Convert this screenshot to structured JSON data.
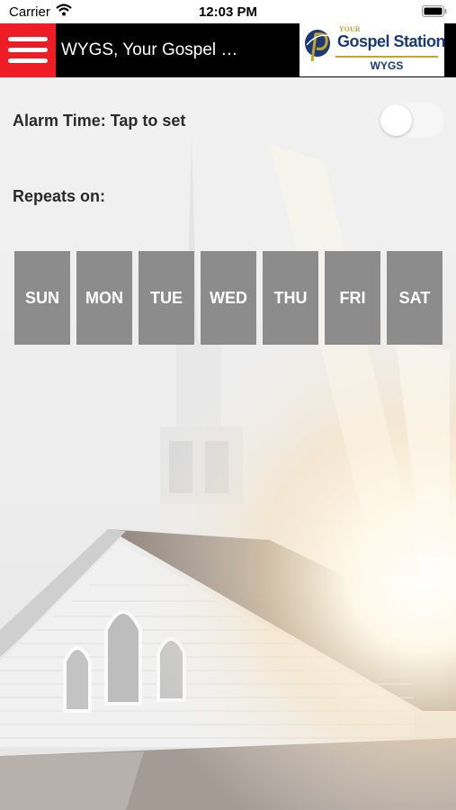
{
  "status_bar": {
    "carrier": "Carrier",
    "time": "12:03 PM"
  },
  "nav": {
    "title": "WYGS, Your Gospel …",
    "logo": {
      "your": "YOUR",
      "name": "Gospel Station",
      "callsign": "WYGS"
    }
  },
  "alarm": {
    "label": "Alarm Time: Tap to set",
    "enabled": false
  },
  "repeats": {
    "label": "Repeats on:",
    "days": [
      "SUN",
      "MON",
      "TUE",
      "WED",
      "THU",
      "FRI",
      "SAT"
    ]
  },
  "colors": {
    "menu_red": "#ee1c24",
    "nav_black": "#000000",
    "day_gray": "#8c8c8c",
    "logo_blue": "#1a3a7a",
    "logo_gold": "#c9a227"
  }
}
